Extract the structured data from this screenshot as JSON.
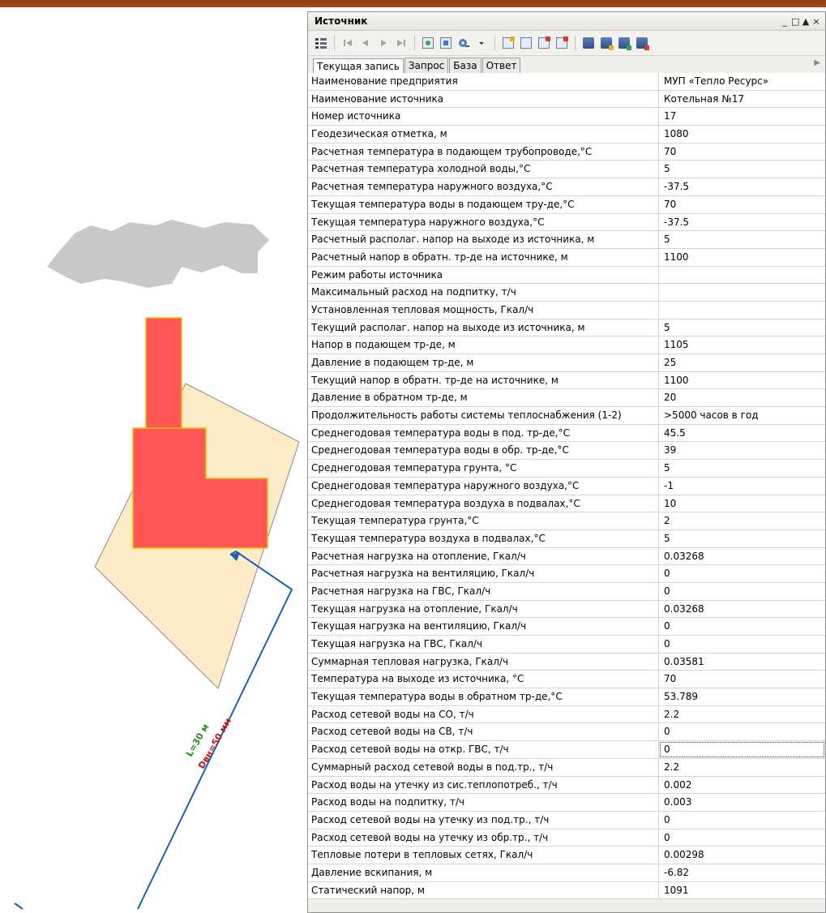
{
  "window": {
    "title": "Источник",
    "controls": {
      "minimize": "_",
      "restore": "□",
      "arrow": "▲",
      "close": "×"
    }
  },
  "toolbar": {
    "buttons": [
      "grid-menu-icon",
      "first-record-icon",
      "prev-record-icon",
      "next-record-icon",
      "last-record-icon",
      "refresh-icon",
      "recalc-icon",
      "search-icon",
      "dropdown-icon",
      "new-doc-icon",
      "edit-doc-icon",
      "add-doc-icon",
      "delete-doc-icon",
      "db-table-icon",
      "db-edit-icon",
      "db-add-icon",
      "db-settings-icon"
    ]
  },
  "tabs": [
    "Текущая запись",
    "Запрос",
    "База",
    "Ответ"
  ],
  "active_tab": 0,
  "rows": [
    {
      "name": "Наименование предприятия",
      "value": "МУП «Тепло Ресурс»"
    },
    {
      "name": "Наименование источника",
      "value": "Котельная №17"
    },
    {
      "name": "Номер источника",
      "value": "17"
    },
    {
      "name": "Геодезическая отметка, м",
      "value": "1080"
    },
    {
      "name": "Расчетная температура в подающем трубопроводе,°С",
      "value": "70"
    },
    {
      "name": "Расчетная температура холодной воды,°С",
      "value": "5"
    },
    {
      "name": "Расчетная температура наружного воздуха,°С",
      "value": "-37.5"
    },
    {
      "name": "Текущая температура воды в подающем тру-де,°С",
      "value": "70"
    },
    {
      "name": "Текущая температура  наружного воздуха,°С",
      "value": "-37.5"
    },
    {
      "name": "Расчетный располаг. напор на выходе из источника, м",
      "value": "5"
    },
    {
      "name": "Расчетный напор в обратн. тр-де на источнике, м",
      "value": "1100"
    },
    {
      "name": "Режим работы источника",
      "value": ""
    },
    {
      "name": "Максимальный расход на подпитку, т/ч",
      "value": ""
    },
    {
      "name": "Установленная тепловая мощность, Гкал/ч",
      "value": ""
    },
    {
      "name": "Текущий располаг. напор на выходе из источника, м",
      "value": "5"
    },
    {
      "name": "Напор в подающем тр-де, м",
      "value": "1105"
    },
    {
      "name": "Давление в подающем тр-де, м",
      "value": "25"
    },
    {
      "name": "Текущий напор в обратн. тр-де на источнике, м",
      "value": "1100"
    },
    {
      "name": "Давление в обратном тр-де, м",
      "value": "20"
    },
    {
      "name": "Продолжительность работы системы теплоснабжения (1-2)",
      "value": ">5000 часов в год"
    },
    {
      "name": "Среднегодовая температура воды в под. тр-де,°С",
      "value": "45.5"
    },
    {
      "name": "Среднегодовая температура воды в обр. тр-де,°С",
      "value": "39"
    },
    {
      "name": "Среднегодовая температура грунта, °С",
      "value": "5"
    },
    {
      "name": "Среднегодовая температура наружного воздуха,°С",
      "value": "-1"
    },
    {
      "name": "Среднегодовая температура воздуха в подвалах,°С",
      "value": "10"
    },
    {
      "name": "Текущая температура грунта,°С",
      "value": "2"
    },
    {
      "name": "Текущая температура воздуха в подвалах,°С",
      "value": "5"
    },
    {
      "name": "Расчетная нагрузка на отопление, Гкал/ч",
      "value": "0.03268"
    },
    {
      "name": "Расчетная нагрузка на вентиляцию, Гкал/ч",
      "value": "0"
    },
    {
      "name": "Расчетная нагрузка на ГВС, Гкал/ч",
      "value": "0"
    },
    {
      "name": "Текущая нагрузка на отопление, Гкал/ч",
      "value": "0.03268"
    },
    {
      "name": "Текущая нагрузка на вентиляцию, Гкал/ч",
      "value": "0"
    },
    {
      "name": "Текущая нагрузка на ГВС, Гкал/ч",
      "value": "0"
    },
    {
      "name": "Суммарная тепловая нагрузка, Гкал/ч",
      "value": "0.03581"
    },
    {
      "name": "Температура на выходе из источника, °С",
      "value": "70"
    },
    {
      "name": "Текущая температура воды в обратном тр-де,°С",
      "value": "53.789"
    },
    {
      "name": "Расход сетевой воды на СО, т/ч",
      "value": "2.2"
    },
    {
      "name": "Расход сетевой воды на СВ, т/ч",
      "value": "0"
    },
    {
      "name": "Расход сетевой воды на откр. ГВС, т/ч",
      "value": "0"
    },
    {
      "name": "Суммарный расход сетевой воды в под.тр., т/ч",
      "value": "2.2"
    },
    {
      "name": "Расход воды на утечку из сис.теплопотреб., т/ч",
      "value": "0.002"
    },
    {
      "name": "Расход воды на подпитку, т/ч",
      "value": "0.003"
    },
    {
      "name": "Расход сетевой воды на утечку из под.тр., т/ч",
      "value": "0"
    },
    {
      "name": "Расход сетевой воды на утечку из обр.тр., т/ч",
      "value": "0"
    },
    {
      "name": "Тепловые потери в тепловых сетях, Гкал/ч",
      "value": "0.00298"
    },
    {
      "name": "Давление вскипания, м",
      "value": "-6.82"
    },
    {
      "name": "Статический напор, м",
      "value": "1091"
    }
  ],
  "focused_row": 38,
  "map": {
    "pipe_length_label": "L=30 м",
    "pipe_diameter_label": "Dвн=50 мм",
    "colors": {
      "building": "#ff5555",
      "building_outline": "#e8c300",
      "parcel": "#fdebc8",
      "terrain": "#c8c8c8",
      "pipe": "#1a5fb8",
      "length_label": "#2a8c1a",
      "diameter_label": "#c0171c"
    }
  }
}
